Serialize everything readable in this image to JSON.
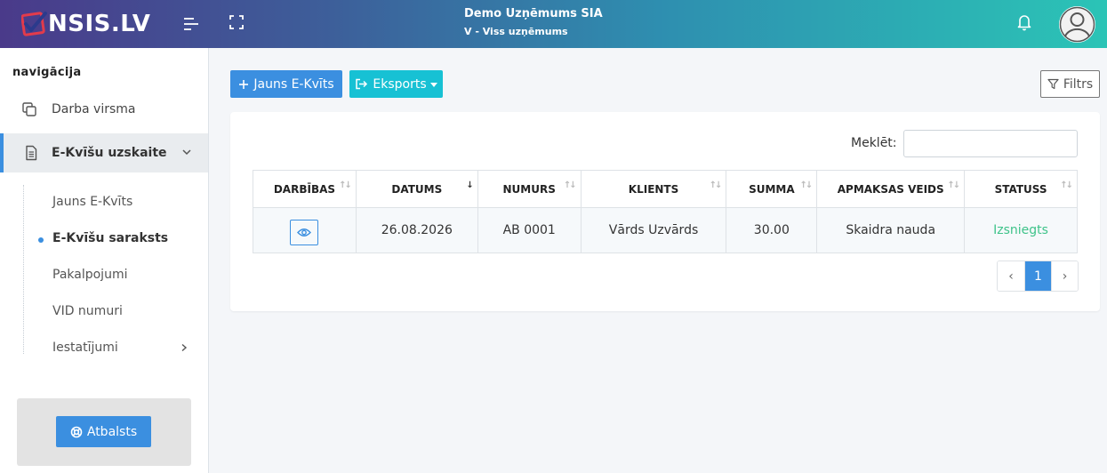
{
  "header": {
    "logo_text": "NSIS.LV",
    "company_name": "Demo Uzņēmums SIA",
    "company_sub": "V - Viss uzņēmums",
    "icons": [
      "menu-toggle-icon",
      "fullscreen-icon",
      "bell-icon",
      "user-avatar-icon"
    ]
  },
  "sidebar": {
    "heading": "navigācija",
    "items": [
      {
        "label": "Darba virsma",
        "icon": "copy-icon"
      },
      {
        "label": "E-Kvīšu uzskaite",
        "icon": "document-icon",
        "active": true
      }
    ],
    "sub_items": [
      {
        "label": "Jauns E-Kvīts"
      },
      {
        "label": "E-Kvīšu saraksts",
        "current": true
      },
      {
        "label": "Pakalpojumi"
      },
      {
        "label": "VID numuri"
      },
      {
        "label": "Iestatījumi",
        "has_children": true
      }
    ],
    "support_label": "Atbalsts"
  },
  "toolbar": {
    "new_label": "Jauns E-Kvīts",
    "export_label": "Eksports",
    "filter_label": "Filtrs"
  },
  "search": {
    "label": "Meklēt:",
    "value": "",
    "placeholder": ""
  },
  "table": {
    "columns": [
      "DARBĪBAS",
      "DATUMS",
      "NUMURS",
      "KLIENTS",
      "SUMMA",
      "APMAKSAS VEIDS",
      "STATUSS"
    ],
    "rows": [
      {
        "date": "26.08.2026",
        "number": "AB 0001",
        "client": "Vārds Uzvārds",
        "sum": "30.00",
        "payment": "Skaidra nauda",
        "status": "Izsniegts"
      }
    ]
  },
  "pagination": {
    "prev": "‹",
    "current": "1",
    "next": "›"
  },
  "colors": {
    "primary": "#3b8fe0",
    "info": "#17c1d4",
    "success": "#3fc38a"
  }
}
